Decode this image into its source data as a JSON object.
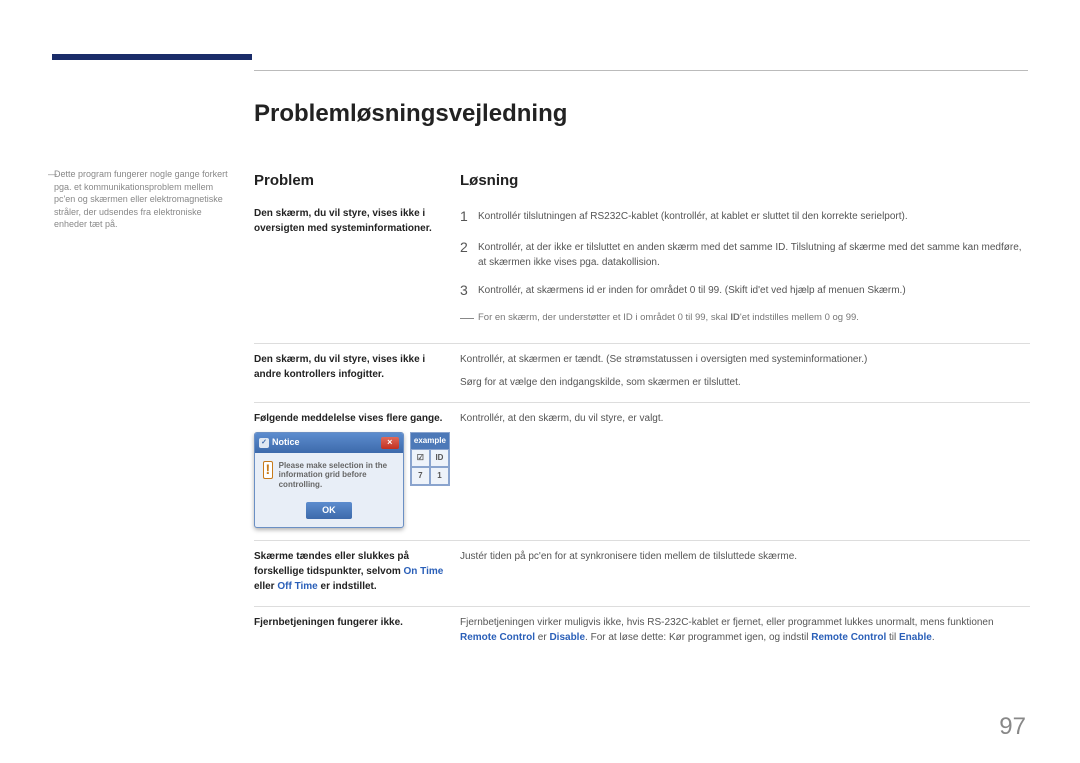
{
  "heading": "Problemløsningsvejledning",
  "sidenote": "Dette program fungerer nogle gange forkert pga. et kommunikationsproblem mellem pc'en og skærmen eller elektromagnetiske stråler, der udsendes fra elektroniske enheder tæt på.",
  "columns": {
    "problem": "Problem",
    "solution": "Løsning"
  },
  "rows": [
    {
      "problem": "Den skærm, du vil styre, vises ikke i oversigten med systeminformationer.",
      "steps": [
        "Kontrollér tilslutningen af RS232C-kablet (kontrollér, at kablet er sluttet til den korrekte serielport).",
        "Kontrollér, at der ikke er tilsluttet en anden skærm med det samme ID. Tilslutning af skærme med det samme  kan medføre, at skærmen ikke vises pga. datakollision.",
        "Kontrollér, at skærmens id er inden for området 0 til 99. (Skift id'et ved hjælp af menuen Skærm.)"
      ],
      "note_pre": "For en skærm, der understøtter et ID i området 0 til 99, skal ",
      "note_bold": "ID",
      "note_post": "'et indstilles mellem 0 og 99."
    },
    {
      "problem": "Den skærm, du vil styre, vises ikke i andre kontrollers infogitter.",
      "paragraphs": [
        "Kontrollér, at skærmen er tændt. (Se strømstatussen i oversigten med systeminformationer.)",
        "Sørg for at vælge den indgangskilde, som skærmen er tilsluttet."
      ]
    },
    {
      "problem": "Følgende meddelelse vises flere gange.",
      "dialog": {
        "title": "Notice",
        "body": "Please make selection in the information grid before controlling.",
        "ok": "OK",
        "ex_label": "example",
        "c1": "☑",
        "c2": "ID",
        "c3": "7",
        "c4": "1"
      },
      "paragraphs": [
        "Kontrollér, at den skærm, du vil styre, er valgt."
      ]
    },
    {
      "problem_pre": "Skærme tændes eller slukkes på forskellige tidspunkter, selvom ",
      "problem_blue1": "On Time",
      "problem_mid": " eller ",
      "problem_blue2": "Off Time",
      "problem_post": " er indstillet.",
      "paragraphs": [
        "Justér tiden på pc'en for at synkronisere tiden mellem de tilsluttede skærme."
      ]
    },
    {
      "problem": "Fjernbetjeningen fungerer ikke.",
      "rich_solution": {
        "t1": "Fjernbetjeningen virker muligvis ikke, hvis RS-232C-kablet er fjernet, eller programmet lukkes unormalt, mens funktionen ",
        "b1": "Remote Control",
        "t2": " er ",
        "b2": "Disable",
        "t3": ". For at løse dette: Kør programmet igen, og indstil ",
        "b3": "Remote Control",
        "t4": " til ",
        "b4": "Enable",
        "t5": "."
      }
    }
  ],
  "page_number": "97"
}
